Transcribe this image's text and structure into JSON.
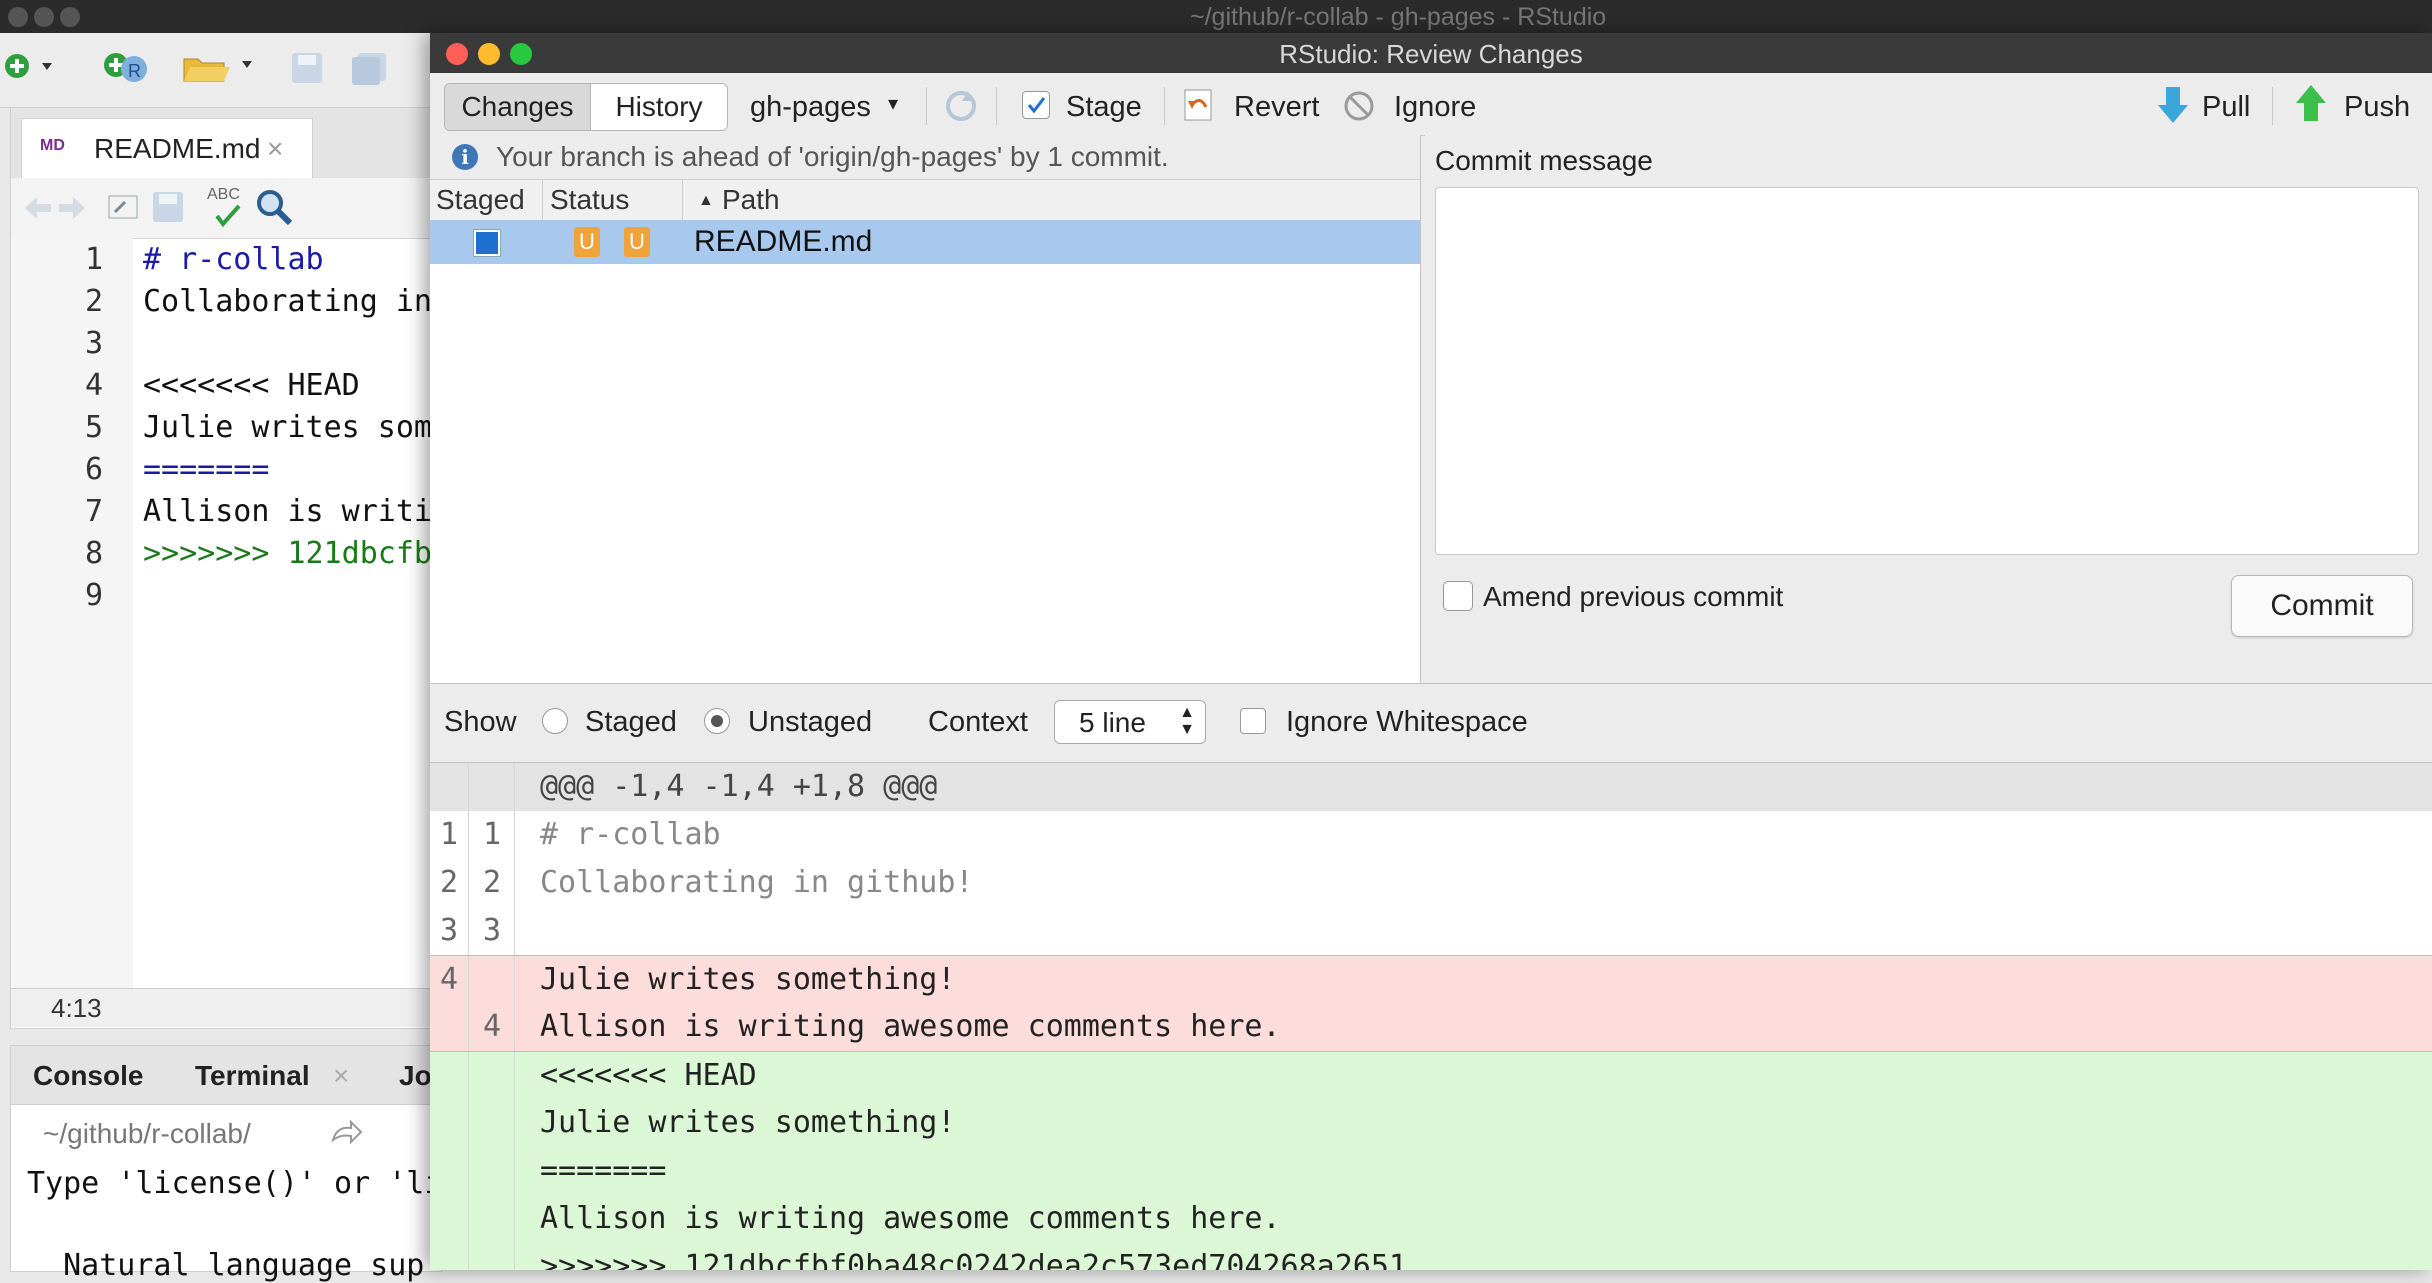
{
  "main_window": {
    "title": "~/github/r-collab - gh-pages - RStudio"
  },
  "editor": {
    "tab_label": "README.md",
    "tab_icon_text": "MD",
    "tab_close": "×",
    "spellcheck_label": "ABC",
    "line_numbers": [
      "1",
      "2",
      "3",
      "4",
      "5",
      "6",
      "7",
      "8",
      "9"
    ],
    "lines": [
      {
        "text": "# r-collab",
        "color": "#1a1aa6"
      },
      {
        "text": "Collaborating in",
        "color": "#111111"
      },
      {
        "text": "",
        "color": "#111111"
      },
      {
        "text": "<<<<<<< HEAD",
        "color": "#111111"
      },
      {
        "text": "Julie writes som",
        "color": "#111111"
      },
      {
        "text": "=======",
        "color": "#1a1aa6"
      },
      {
        "text": "Allison is writi",
        "color": "#111111"
      },
      {
        "text": ">>>>>>> 121dbcfb",
        "color": "#1a7a1a"
      },
      {
        "text": "",
        "color": "#111111"
      }
    ],
    "cursor_position": "4:13"
  },
  "console": {
    "tabs": [
      "Console",
      "Terminal",
      "Jo"
    ],
    "terminal_close": "×",
    "path": "~/github/r-collab/",
    "lines": [
      "Type 'license()' or 'li",
      "  Natural language sup"
    ]
  },
  "review_changes": {
    "title": "RStudio: Review Changes",
    "tabs": {
      "changes": "Changes",
      "history": "History"
    },
    "branch": "gh-pages",
    "branch_arrow": "▾",
    "buttons": {
      "stage": "Stage",
      "revert": "Revert",
      "ignore": "Ignore",
      "pull": "Pull",
      "push": "Push"
    },
    "ahead_message": "Your branch is ahead of 'origin/gh-pages' by 1 commit.",
    "ahead_icon": "i",
    "table": {
      "headers": {
        "staged": "Staged",
        "status": "Status",
        "path": "Path"
      },
      "sort_arrow": "▲",
      "rows": [
        {
          "status_index": "U",
          "status_worktree": "U",
          "path": "README.md"
        }
      ]
    },
    "commit": {
      "label": "Commit message",
      "message": "",
      "amend_label": "Amend previous commit",
      "button": "Commit"
    },
    "diff_controls": {
      "show_label": "Show",
      "staged_label": "Staged",
      "unstaged_label": "Unstaged",
      "selected": "Unstaged",
      "context_label": "Context",
      "context_value": "5 line",
      "context_arrows": "▲\n▼",
      "ignore_whitespace_label": "Ignore Whitespace"
    },
    "diff": {
      "hunk_header": "@@@ -1,4 -1,4 +1,8 @@@",
      "rows": [
        {
          "n1": "1",
          "n2": "1",
          "text": "# r-collab",
          "type": "context"
        },
        {
          "n1": "2",
          "n2": "2",
          "text": "Collaborating in github!",
          "type": "context"
        },
        {
          "n1": "3",
          "n2": "3",
          "text": "",
          "type": "context"
        },
        {
          "n1": "4",
          "n2": "",
          "text": "Julie writes something!",
          "type": "removed"
        },
        {
          "n1": "",
          "n2": "4",
          "text": "Allison is writing awesome comments here.",
          "type": "removed"
        },
        {
          "n1": "",
          "n2": "",
          "text": "<<<<<<< HEAD",
          "type": "added"
        },
        {
          "n1": "",
          "n2": "",
          "text": "Julie writes something!",
          "type": "added"
        },
        {
          "n1": "",
          "n2": "",
          "text": "=======",
          "type": "added"
        },
        {
          "n1": "",
          "n2": "",
          "text": "Allison is writing awesome comments here.",
          "type": "added"
        },
        {
          "n1": "",
          "n2": "",
          "text": ">>>>>>> 121dbcfbf0ba48c0242dea2c573ed704268a2651",
          "type": "added"
        }
      ],
      "colors": {
        "context_bg": "#ffffff",
        "context_fg": "#888888",
        "removed_bg": "#fddcdc",
        "added_bg": "#dcf7d6",
        "changed_fg": "#222222",
        "hunk_bg": "#e3e3e3"
      }
    }
  }
}
